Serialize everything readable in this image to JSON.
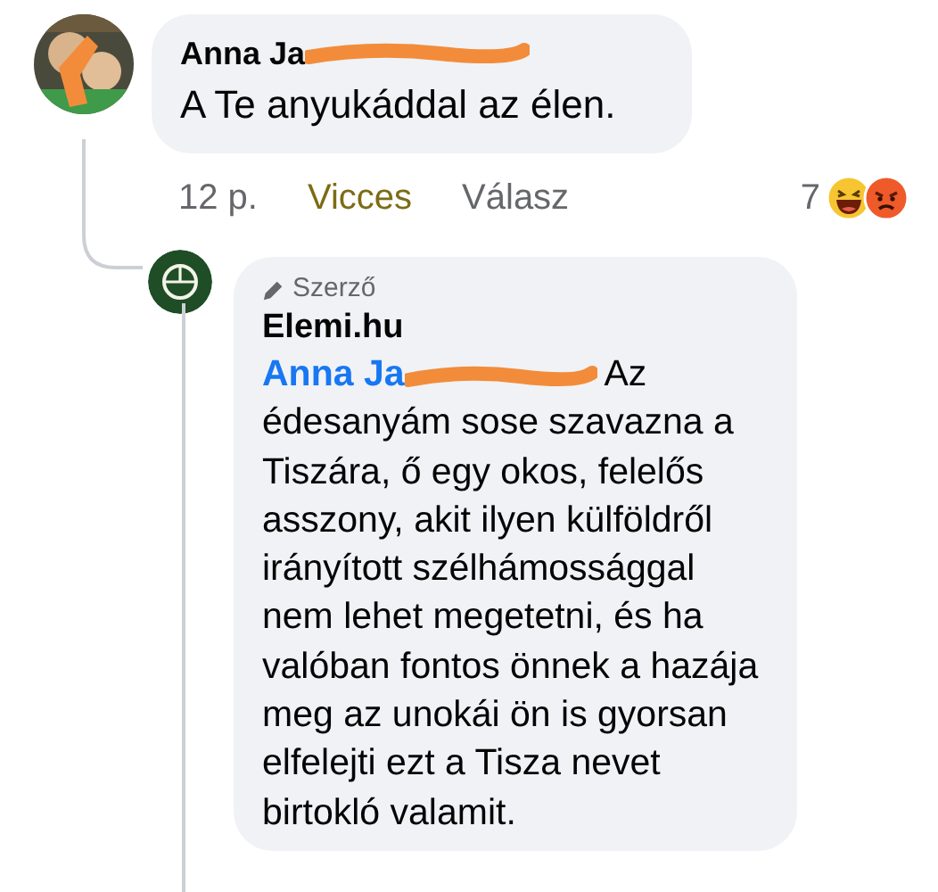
{
  "comment": {
    "author": "Anna Ja",
    "text": "A Te anyukáddal az élen.",
    "time": "12 p.",
    "reaction": {
      "label": "Vicces",
      "selected": true
    },
    "reply_label": "Válasz",
    "reaction_count": "7"
  },
  "reply": {
    "badge": "Szerző",
    "author": "Elemi.hu",
    "mention": "Anna Ja",
    "text": "Az édesanyám sose szavazna a Tiszára, ő egy okos, felelős asszony, akit ilyen külföldről irányított szélhámossággal nem lehet megetetni, és ha valóban fontos önnek a hazája meg az unokái ön is gyorsan elfelejti ezt a Tisza nevet birtokló valamit."
  }
}
